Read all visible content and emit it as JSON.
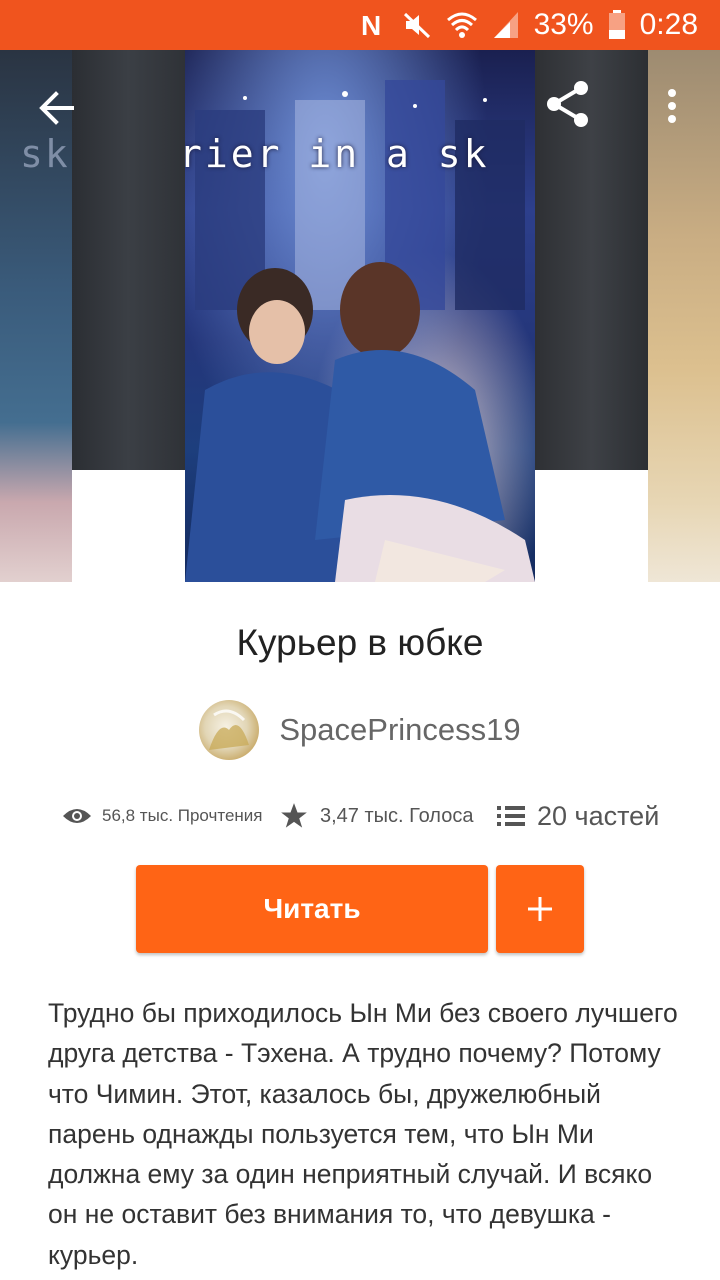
{
  "status_bar": {
    "battery": "33%",
    "time": "0:28",
    "icons": [
      "nfc-icon",
      "mute-icon",
      "wifi-icon",
      "signal-icon",
      "battery-icon"
    ],
    "background": "#f0541e"
  },
  "toolbar": {
    "back_icon": "back-arrow-icon",
    "share_icon": "share-icon",
    "more_icon": "more-vert-icon"
  },
  "cover": {
    "main_cover_text": "rier in a sk",
    "left_cover_text": "sk"
  },
  "book": {
    "title": "Курьер в юбке",
    "author": "SpacePrincess19"
  },
  "stats": {
    "reads": "56,8 тыс. Прочтения",
    "votes": "3,47 тыс. Голоса",
    "parts": "20 частей"
  },
  "actions": {
    "read_label": "Читать",
    "add_icon": "plus-icon",
    "accent": "#ff6415"
  },
  "description": "Трудно бы приходилось Ын Ми без своего лучшего друга детства - Тэхена. А трудно почему? Потому что Чимин. Этот, казалось бы, дружелюбный парень однажды пользуется тем, что Ын Ми должна ему за один неприятный случай. И всяко он не оставит без внимания то, что девушка - курьер."
}
